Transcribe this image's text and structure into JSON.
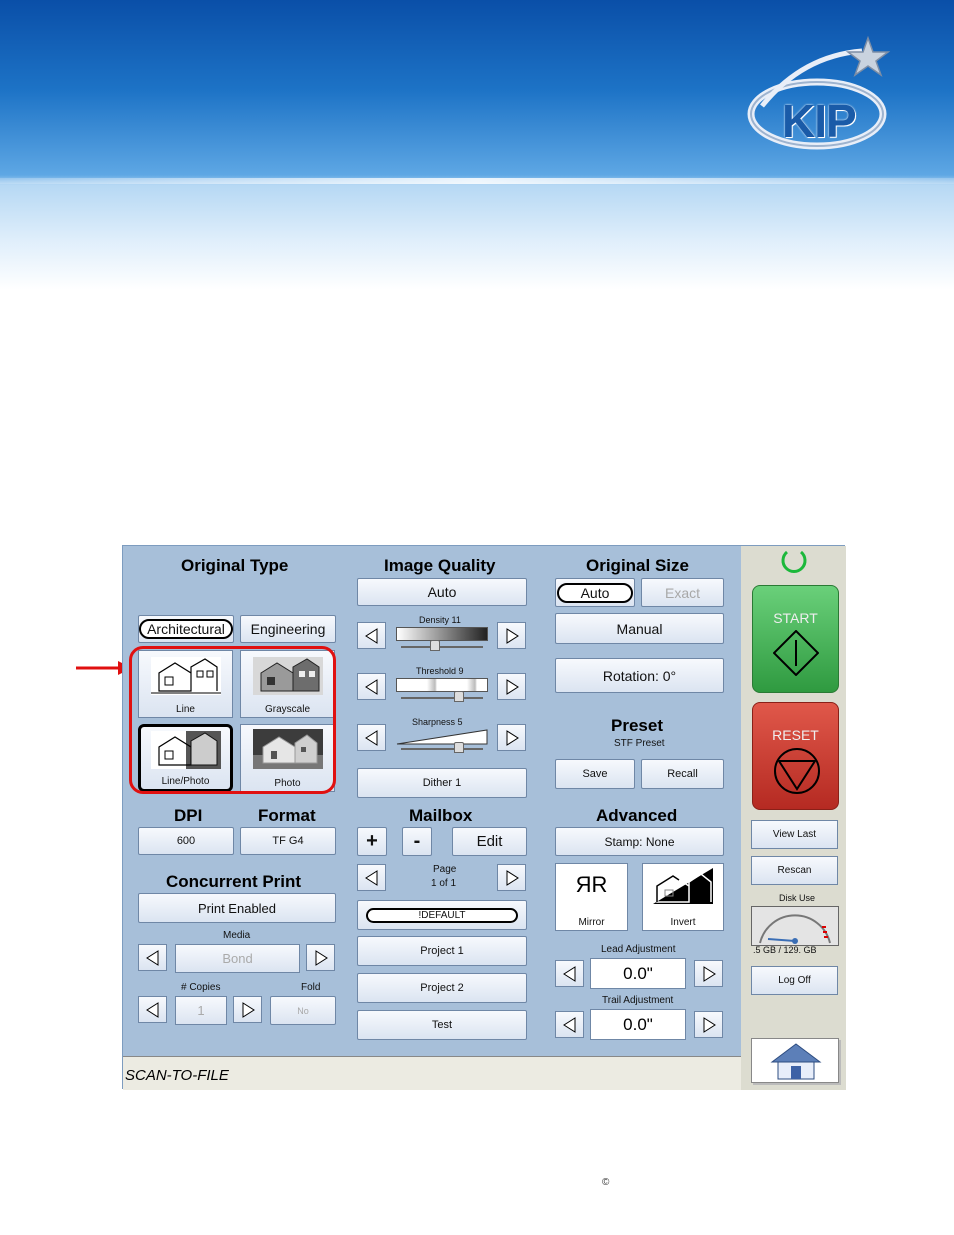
{
  "colors": {
    "screen_bg": "#a7bfd9",
    "start_green": "#3aa04a",
    "reset_red": "#c83a2e",
    "callout_red": "#e01010"
  },
  "original_type": {
    "title": "Original Type",
    "modes": [
      "Architectural",
      "Engineering"
    ],
    "thumbs": [
      "Line",
      "Grayscale",
      "Line/Photo",
      "Photo"
    ]
  },
  "image_quality": {
    "title": "Image Quality",
    "auto_label": "Auto",
    "density_label": "Density 11",
    "threshold_label": "Threshold 9",
    "sharpness_label": "Sharpness 5",
    "dither_label": "Dither 1"
  },
  "original_size": {
    "title": "Original Size",
    "auto_label": "Auto",
    "exact_label": "Exact",
    "manual_label": "Manual",
    "rotation_label": "Rotation: 0°"
  },
  "preset": {
    "title": "Preset",
    "subtitle": "STF Preset",
    "save_label": "Save",
    "recall_label": "Recall"
  },
  "dpi": {
    "title": "DPI",
    "value": "600"
  },
  "format": {
    "title": "Format",
    "value": "TF G4"
  },
  "mailbox": {
    "title": "Mailbox",
    "plus": "+",
    "minus": "-",
    "edit_label": "Edit",
    "page_label": "Page",
    "page_value": "1 of 1",
    "items": [
      "!DEFAULT",
      "Project 1",
      "Project 2",
      "Test"
    ]
  },
  "advanced": {
    "title": "Advanced",
    "stamp_label": "Stamp: None",
    "mirror_label": "Mirror",
    "mirror_glyph": "ЯR",
    "invert_label": "Invert",
    "lead_label": "Lead Adjustment",
    "lead_value": "0.0\"",
    "trail_label": "Trail Adjustment",
    "trail_value": "0.0\""
  },
  "concurrent_print": {
    "title": "Concurrent Print",
    "print_enabled_label": "Print Enabled",
    "media_label": "Media",
    "media_value": "Bond",
    "copies_label": "# Copies",
    "copies_value": "1",
    "fold_label": "Fold",
    "fold_value": "No"
  },
  "side": {
    "start_label": "START",
    "reset_label": "RESET",
    "view_last_label": "View Last",
    "rescan_label": "Rescan",
    "disk_use_label": "Disk Use",
    "disk_use_value": ".5 GB / 129. GB",
    "log_off_label": "Log Off"
  },
  "status_text": "SCAN-TO-FILE",
  "logo_text": "KIP",
  "copyright_symbol": "©"
}
